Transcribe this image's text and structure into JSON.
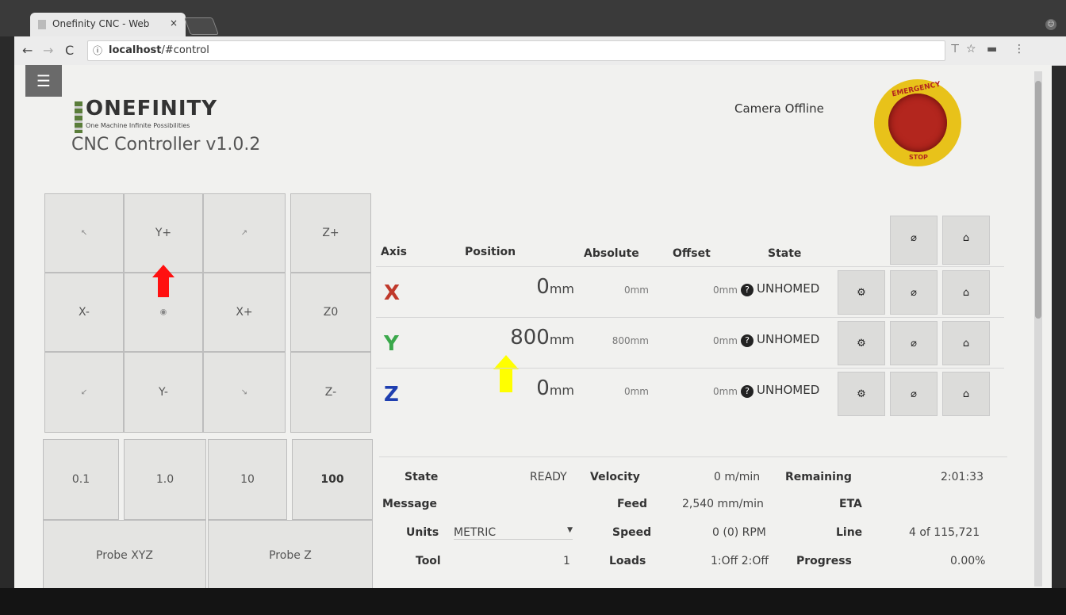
{
  "browser": {
    "tab_title": "Onefinity CNC - Web",
    "tab_close": "×",
    "url_host": "localhost",
    "url_path": "/#control",
    "info_icon": "info-icon"
  },
  "header": {
    "brand": "ONEFINITY",
    "tagline": "One Machine Infinite Possibilities",
    "subtitle": "CNC Controller v1.0.2",
    "camera_status": "Camera Offline",
    "estop_top": "EMERGENCY",
    "estop_bottom": "STOP"
  },
  "jog": {
    "y_plus": "Y+",
    "z_plus": "Z+",
    "x_minus": "X-",
    "x_plus": "X+",
    "z_zero": "Z0",
    "y_minus": "Y-",
    "z_minus": "Z-",
    "steps": [
      "0.1",
      "1.0",
      "10",
      "100"
    ],
    "probe_xyz": "Probe XYZ",
    "probe_z": "Probe Z"
  },
  "axes": {
    "headers": {
      "axis": "Axis",
      "position": "Position",
      "absolute": "Absolute",
      "offset": "Offset",
      "state": "State"
    },
    "rows": [
      {
        "axis": "X",
        "color": "#c0392b",
        "position": "0",
        "unit": "mm",
        "absolute": "0",
        "abs_unit": "mm",
        "offset": "0",
        "off_unit": "mm",
        "state": "UNHOMED"
      },
      {
        "axis": "Y",
        "color": "#3aa84a",
        "position": "800",
        "unit": "mm",
        "absolute": "800",
        "abs_unit": "mm",
        "offset": "0",
        "off_unit": "mm",
        "state": "UNHOMED"
      },
      {
        "axis": "Z",
        "color": "#1f3fb0",
        "position": "0",
        "unit": "mm",
        "absolute": "0",
        "abs_unit": "mm",
        "offset": "0",
        "off_unit": "mm",
        "state": "UNHOMED"
      }
    ]
  },
  "status": {
    "state_label": "State",
    "state_value": "READY",
    "message_label": "Message",
    "message_value": "",
    "units_label": "Units",
    "units_value": "METRIC",
    "tool_label": "Tool",
    "tool_value": "1",
    "velocity_label": "Velocity",
    "velocity_value": "0 m/min",
    "feed_label": "Feed",
    "feed_value": "2,540 mm/min",
    "speed_label": "Speed",
    "speed_value": "0 (0) RPM",
    "loads_label": "Loads",
    "loads_value": "1:Off 2:Off",
    "remaining_label": "Remaining",
    "remaining_value": "2:01:33",
    "eta_label": "ETA",
    "eta_value": "",
    "line_label": "Line",
    "line_value": "4 of 115,721",
    "progress_label": "Progress",
    "progress_value": "0.00%"
  }
}
